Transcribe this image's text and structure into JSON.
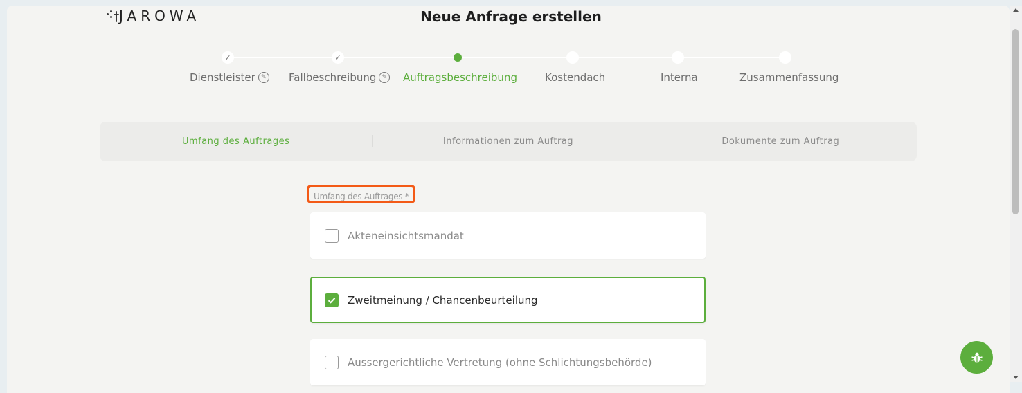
{
  "header": {
    "logo_text": "JAROWA",
    "page_title": "Neue Anfrage erstellen"
  },
  "stepper": {
    "steps": [
      {
        "label": "Dienstleister",
        "state": "done",
        "editable": true
      },
      {
        "label": "Fallbeschreibung",
        "state": "done",
        "editable": true
      },
      {
        "label": "Auftragsbeschreibung",
        "state": "active",
        "editable": false
      },
      {
        "label": "Kostendach",
        "state": "pending",
        "editable": false
      },
      {
        "label": "Interna",
        "state": "pending",
        "editable": false
      },
      {
        "label": "Zusammenfassung",
        "state": "pending",
        "editable": false
      }
    ]
  },
  "tabs": [
    {
      "label": "Umfang des Auftrages",
      "active": true
    },
    {
      "label": "Informationen zum Auftrag",
      "active": false
    },
    {
      "label": "Dokumente zum Auftrag",
      "active": false
    }
  ],
  "form": {
    "field_label": "Umfang des Auftrages *",
    "options": [
      {
        "label": "Akteneinsichtsmandat",
        "checked": false
      },
      {
        "label": "Zweitmeinung / Chancenbeurteilung",
        "checked": true
      },
      {
        "label": "Aussergerichtliche Vertretung (ohne Schlichtungsbehörde)",
        "checked": false
      }
    ]
  },
  "colors": {
    "accent": "#5cae3d",
    "highlight": "#f35a17",
    "background": "#f4f4f2"
  },
  "icons": {
    "fab": "bug-icon",
    "edit": "pencil-icon",
    "done": "check-icon"
  }
}
